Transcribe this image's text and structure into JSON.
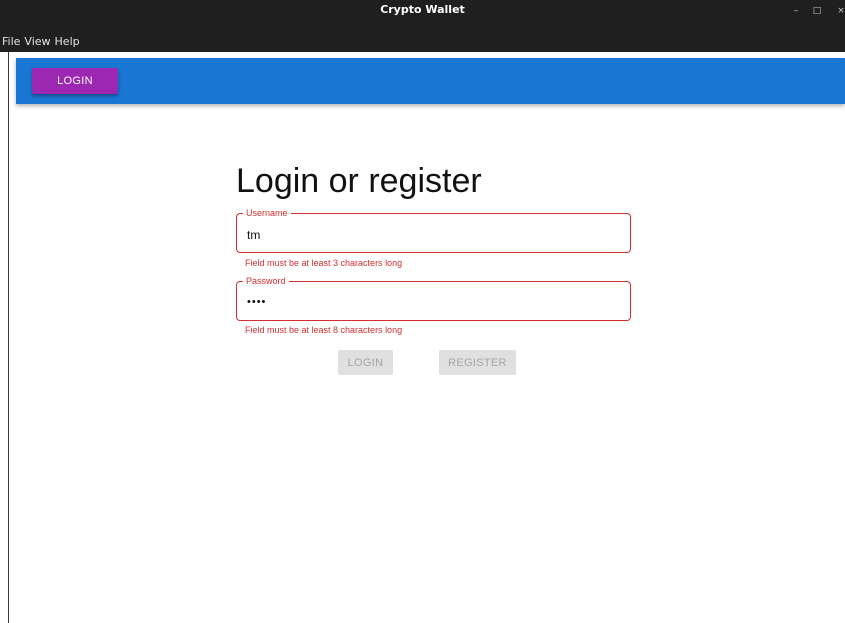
{
  "window": {
    "title": "Crypto Wallet",
    "controls": {
      "minimize": "–",
      "maximize": "□",
      "close": "×"
    }
  },
  "menu": {
    "items": [
      "File",
      "View",
      "Help"
    ]
  },
  "appbar": {
    "login_label": "LOGIN",
    "bar_color": "#1976d2",
    "button_color": "#9c27b0"
  },
  "form": {
    "heading": "Login or register",
    "username": {
      "label": "Username",
      "value": "tm",
      "error": "Field must be at least 3 characters long"
    },
    "password": {
      "label": "Password",
      "value": "••••",
      "error": "Field must be at least 8 characters long"
    },
    "login_label": "LOGIN",
    "register_label": "REGISTER",
    "error_color": "#d32f2f"
  }
}
